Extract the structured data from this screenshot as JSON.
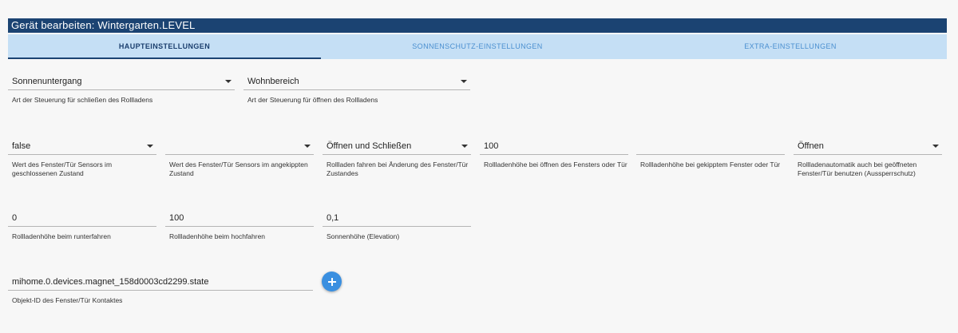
{
  "dialog": {
    "title": "Gerät bearbeiten: Wintergarten.LEVEL"
  },
  "tabs": [
    {
      "label": "HAUPTEINSTELLUNGEN",
      "active": true
    },
    {
      "label": "SONNENSCHUTZ-EINSTELLUNGEN",
      "active": false
    },
    {
      "label": "EXTRA-EINSTELLUNGEN",
      "active": false
    }
  ],
  "row1": {
    "close_control": {
      "value": "Sonnenuntergang",
      "helper": "Art der Steuerung für schließen des Rollladens"
    },
    "open_control": {
      "value": "Wohnbereich",
      "helper": "Art der Steuerung für öffnen des Rollladens"
    }
  },
  "row2": {
    "sensor_closed": {
      "value": "false",
      "helper": "Wert des Fenster/Tür Sensors im geschlossenen Zustand"
    },
    "sensor_tilted": {
      "value": "",
      "helper": "Wert des Fenster/Tür Sensors im angekippten Zustand"
    },
    "move_on_change": {
      "value": "Öffnen und Schließen",
      "helper": "Rollladen fahren bei Änderung des Fenster/Tür Zustandes"
    },
    "height_open": {
      "value": "100",
      "helper": "Rollladenhöhe bei öffnen des Fensters oder Tür"
    },
    "height_tilted": {
      "value": "",
      "helper": "Rollladenhöhe bei gekipptem Fenster oder Tür"
    },
    "lockout": {
      "value": "Öffnen",
      "helper": "Rollladenautomatik auch bei geöffneten Fenster/Tür benutzen (Aussperrschutz)"
    }
  },
  "row3": {
    "height_down": {
      "value": "0",
      "helper": "Rollladenhöhe beim runterfahren"
    },
    "height_up": {
      "value": "100",
      "helper": "Rollladenhöhe beim hochfahren"
    },
    "sun_elevation": {
      "value": "0,1",
      "helper": "Sonnenhöhe (Elevation)"
    }
  },
  "row4": {
    "object_id": {
      "value": "mihome.0.devices.magnet_158d0003cd2299.state",
      "helper": "Objekt-ID des Fenster/Tür Kontaktes"
    },
    "add_button_icon": "plus-icon"
  }
}
